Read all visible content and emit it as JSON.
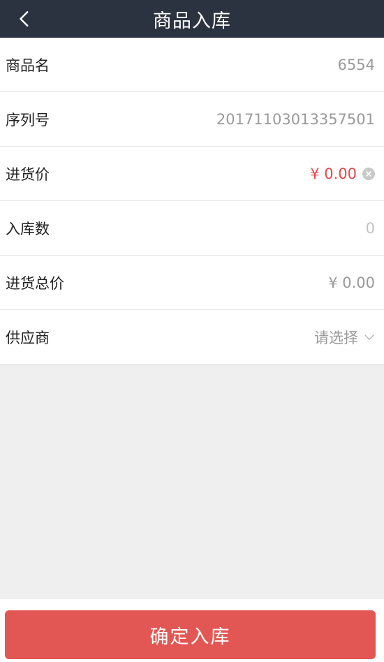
{
  "header": {
    "title": "商品入库",
    "back_icon": "chevron-left-icon"
  },
  "form": {
    "product_name": {
      "label": "商品名",
      "value": "6554"
    },
    "serial_number": {
      "label": "序列号",
      "value": "20171103013357501"
    },
    "purchase_price": {
      "label": "进货价",
      "value": "¥ 0.00",
      "clear_icon": "clear-icon"
    },
    "quantity": {
      "label": "入库数",
      "placeholder": "0"
    },
    "total_price": {
      "label": "进货总价",
      "value": "¥ 0.00"
    },
    "supplier": {
      "label": "供应商",
      "placeholder": "请选择",
      "icon": "chevron-down-icon"
    }
  },
  "footer": {
    "confirm_label": "确定入库"
  },
  "colors": {
    "header_bg": "#2b3340",
    "accent_red": "#e5484d",
    "button_bg": "#e25753",
    "page_bg": "#efefef"
  }
}
